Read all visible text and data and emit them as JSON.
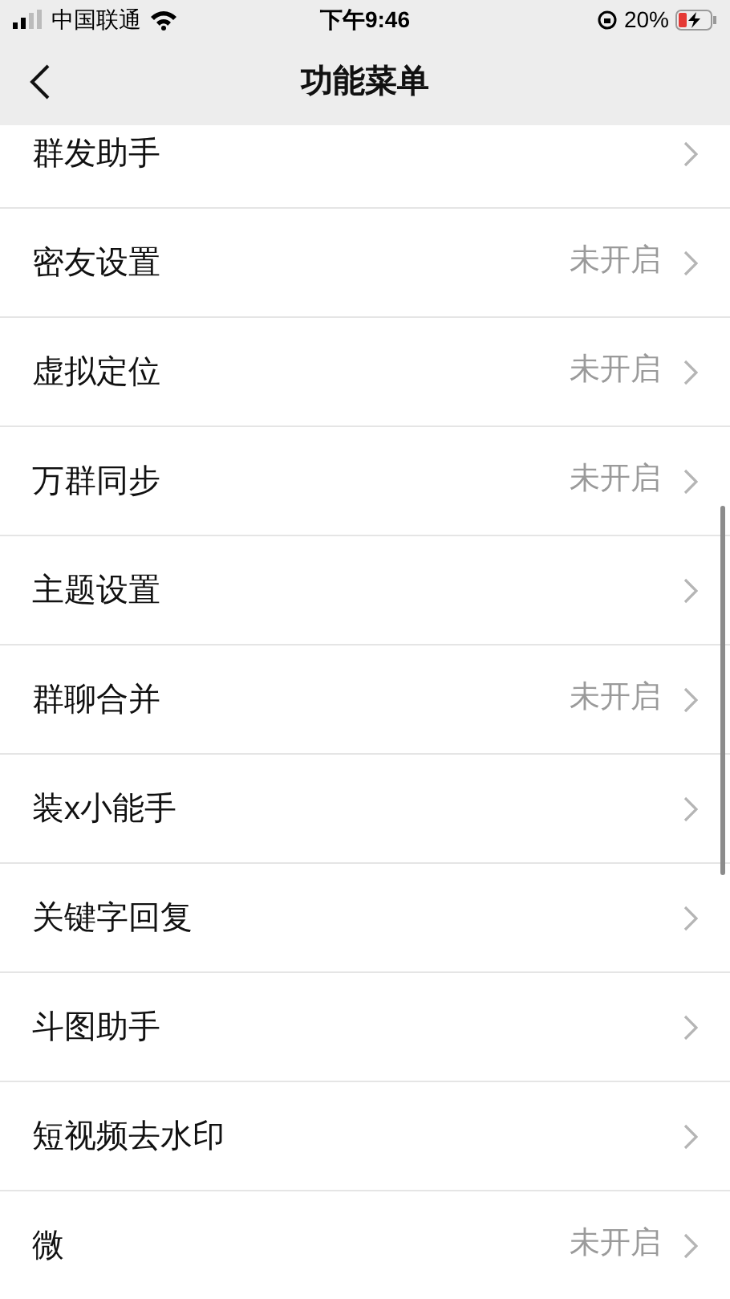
{
  "status_bar": {
    "carrier": "中国联通",
    "time": "下午9:46",
    "battery": "20%"
  },
  "nav": {
    "title": "功能菜单"
  },
  "items": [
    {
      "label": "群发助手"
    },
    {
      "label": "密友设置",
      "status": "未开启"
    },
    {
      "label": "虚拟定位",
      "status": "未开启"
    },
    {
      "label": "万群同步",
      "status": "未开启"
    },
    {
      "label": "主题设置"
    },
    {
      "label": "群聊合并",
      "status": "未开启"
    },
    {
      "label": "装x小能手"
    },
    {
      "label": "关键字回复"
    },
    {
      "label": "斗图助手"
    },
    {
      "label": "短视频去水印"
    },
    {
      "label": "微",
      "status": "未开启"
    }
  ]
}
